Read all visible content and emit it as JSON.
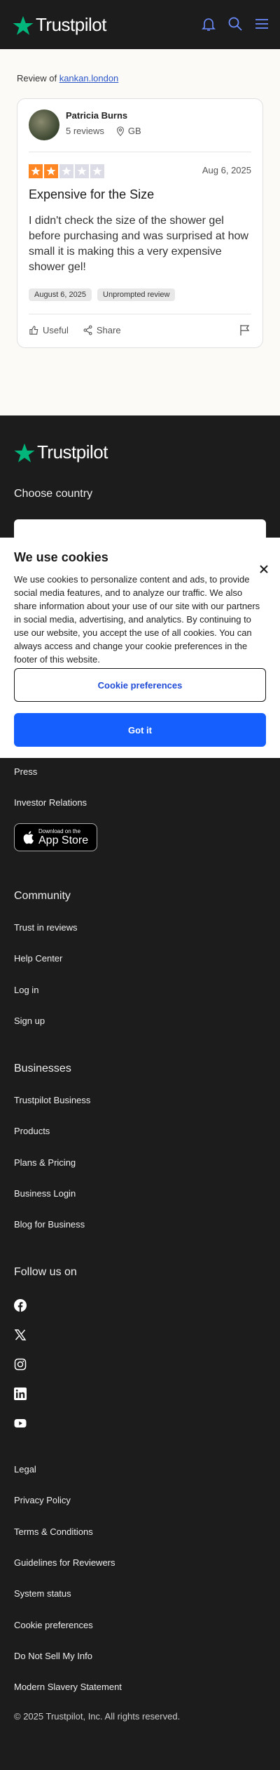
{
  "header": {
    "brand": "Trustpilot",
    "icons": [
      "bell-icon",
      "search-icon",
      "menu-icon"
    ]
  },
  "review_of": {
    "prefix": "Review of",
    "company": "kankan.london"
  },
  "review": {
    "author": "Patricia Burns",
    "review_count": "5 reviews",
    "country": "GB",
    "rating": 2,
    "max_rating": 5,
    "date": "Aug 6, 2025",
    "title": "Expensive for the Size",
    "body": "I didn't check the size of the shower gel before purchasing and was surprised at how small it is making this a very expensive shower gel!",
    "tags": [
      "August 6, 2025",
      "Unprompted review"
    ],
    "actions": {
      "useful": "Useful",
      "share": "Share"
    }
  },
  "footer": {
    "brand": "Trustpilot",
    "choose_country": "Choose country",
    "about_links": [
      "Press",
      "Investor Relations"
    ],
    "app_store": {
      "small": "Download on the",
      "large": "App Store"
    },
    "community": {
      "heading": "Community",
      "links": [
        "Trust in reviews",
        "Help Center",
        "Log in",
        "Sign up"
      ]
    },
    "businesses": {
      "heading": "Businesses",
      "links": [
        "Trustpilot Business",
        "Products",
        "Plans & Pricing",
        "Business Login",
        "Blog for Business"
      ]
    },
    "follow": {
      "heading": "Follow us on",
      "icons": [
        "facebook-icon",
        "x-icon",
        "instagram-icon",
        "linkedin-icon",
        "youtube-icon"
      ]
    },
    "legal_links": [
      "Legal",
      "Privacy Policy",
      "Terms & Conditions",
      "Guidelines for Reviewers",
      "System status",
      "Cookie preferences",
      "Do Not Sell My Info",
      "Modern Slavery Statement"
    ],
    "copyright": "© 2025 Trustpilot, Inc. All rights reserved."
  },
  "cookie_banner": {
    "title": "We use cookies",
    "text": "We use cookies to personalize content and ads, to provide social media features, and to analyze our traffic. We also share information about your use of our site with our partners in social media, advertising, and analytics. By continuing to use our website, you accept the use of all cookies. You can always access and change your cookie preferences in the footer of this website.",
    "preferences_label": "Cookie preferences",
    "accept_label": "Got it"
  },
  "colors": {
    "header_bg": "#1c1c1c",
    "brand_green": "#00b67a",
    "star_orange": "#ff8622",
    "star_empty": "#dcdce6",
    "link_blue": "#2c57c9",
    "button_blue": "#155fff",
    "icon_blue": "#6b8cff"
  }
}
